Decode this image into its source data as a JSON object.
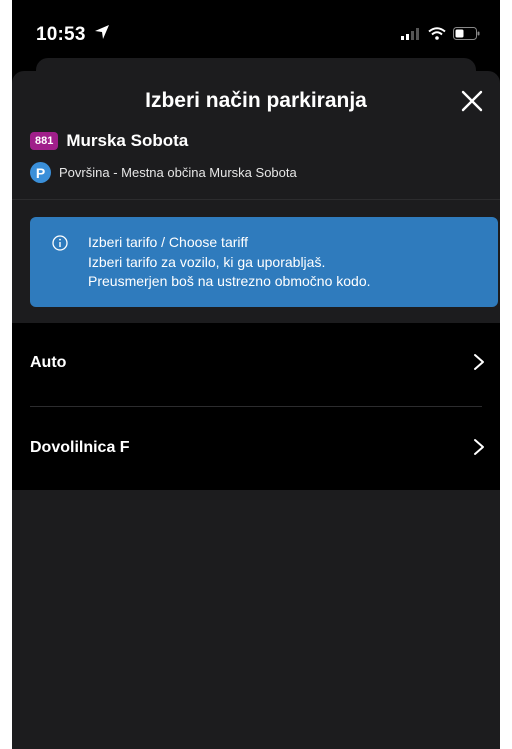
{
  "status_bar": {
    "time": "10:53"
  },
  "sheet": {
    "title": "Izberi način parkiranja",
    "zone": {
      "code": "881",
      "name": "Murska Sobota"
    },
    "place": {
      "icon_letter": "P",
      "text": "Površina - Mestna občina Murska Sobota"
    },
    "info": {
      "title": "Izberi tarifo / Choose tariff",
      "line1": "Izberi tarifo za vozilo, ki ga uporabljaš.",
      "line2": "Preusmerjen boš na ustrezno območno kodo."
    },
    "options": [
      {
        "label": "Auto"
      },
      {
        "label": "Dovolilnica F"
      }
    ]
  },
  "colors": {
    "accent": "#2f7bbd",
    "badge": "#a01f8a",
    "p_icon": "#3a8fd9"
  }
}
